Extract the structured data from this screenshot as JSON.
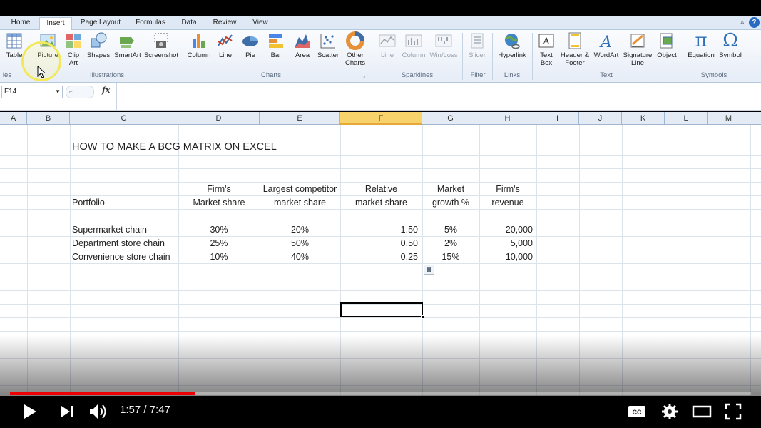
{
  "ribbon": {
    "tabs": [
      {
        "label": "Home"
      },
      {
        "label": "Insert"
      },
      {
        "label": "Page Layout"
      },
      {
        "label": "Formulas"
      },
      {
        "label": "Data"
      },
      {
        "label": "Review"
      },
      {
        "label": "View"
      }
    ],
    "help_label": "?",
    "buttons": {
      "table": "Table",
      "picture": "Picture",
      "clip_art": "Clip Art",
      "shapes": "Shapes",
      "smartart": "SmartArt",
      "screenshot": "Screenshot",
      "column": "Column",
      "line": "Line",
      "pie": "Pie",
      "bar": "Bar",
      "area": "Area",
      "scatter": "Scatter",
      "other_charts": "Other Charts",
      "spark_line": "Line",
      "spark_column": "Column",
      "spark_winloss": "Win/Loss",
      "slicer": "Slicer",
      "hyperlink": "Hyperlink",
      "text_box": "Text Box",
      "header_footer": "Header & Footer",
      "wordart": "WordArt",
      "signature_line": "Signature Line",
      "object": "Object",
      "equation": "Equation",
      "symbol": "Symbol"
    },
    "groups": {
      "tables": "les",
      "illustrations": "Illustrations",
      "charts": "Charts",
      "sparklines": "Sparklines",
      "filter": "Filter",
      "links": "Links",
      "text": "Text",
      "symbols": "Symbols"
    },
    "icon_glyphs": {
      "equation": "π",
      "symbol": "Ω",
      "wordart": "A",
      "textbox": "A"
    }
  },
  "formula_bar": {
    "name_box": "F14",
    "fx": "fx",
    "content": ""
  },
  "columns": [
    "A",
    "B",
    "C",
    "D",
    "E",
    "F",
    "G",
    "H",
    "I",
    "J",
    "K",
    "L",
    "M"
  ],
  "selected_column": "F",
  "sheet": {
    "title": "HOW TO MAKE A BCG MATRIX ON EXCEL",
    "headers": {
      "portfolio": "Portfolio",
      "firms_1": "Firm's",
      "firms_2": "Market share",
      "largest_1": "Largest competitor",
      "largest_2": "market share",
      "relative_1": "Relative",
      "relative_2": "market share",
      "market_1": "Market",
      "market_2": "growth %",
      "revenue_1": "Firm's",
      "revenue_2": "revenue"
    },
    "rows": [
      {
        "name": "Supermarket chain",
        "firm_share": "30%",
        "comp_share": "20%",
        "relative": "1.50",
        "growth": "5%",
        "revenue": "20,000"
      },
      {
        "name": "Department store chain",
        "firm_share": "25%",
        "comp_share": "50%",
        "relative": "0.50",
        "growth": "2%",
        "revenue": "5,000"
      },
      {
        "name": "Convenience store chain",
        "firm_share": "10%",
        "comp_share": "40%",
        "relative": "0.25",
        "growth": "15%",
        "revenue": "10,000"
      }
    ]
  },
  "video": {
    "time": "1:57 / 7:47",
    "progress": 0.25,
    "buffered": 0.25,
    "accent": "#ee0000"
  }
}
